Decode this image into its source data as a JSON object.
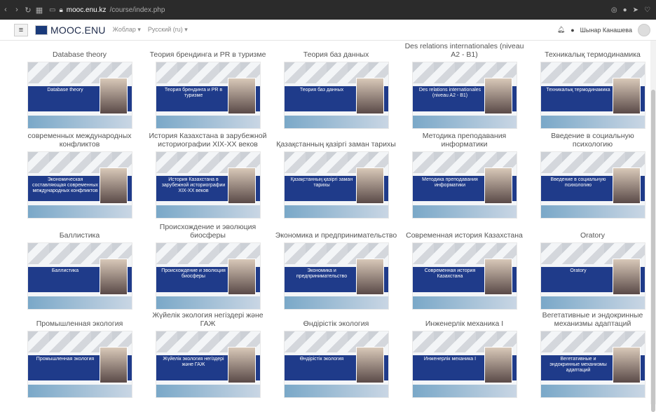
{
  "browser": {
    "url_domain": "mooc.enu.kz",
    "url_path": "/course/index.php",
    "left_icons": [
      "back-icon",
      "forward-icon",
      "reload-icon",
      "apps-icon",
      "tab-icon",
      "lock-icon"
    ],
    "right_icons": [
      "screenshot-icon",
      "shield-icon",
      "send-icon",
      "heart-icon"
    ]
  },
  "header": {
    "site_name": "MOOC.ENU",
    "menu_items": [
      "Жоблар ▾",
      "Русский (ru) ▾"
    ],
    "user_name": "Шынар Канашева"
  },
  "courses": [
    "Database theory",
    "Теория брендинга и PR в туризме",
    "Теория баз данных",
    "Des relations internationales (niveau A2 - B1)",
    "Техникалық термодинамика",
    "Экономическая составляющая современных международных конфликтов",
    "История Казахстана в зарубежной историографии XIX-XX веков",
    "Қазақстанның қазіргі заман тарихы",
    "Методика преподавания информатики",
    "Введение в социальную психологию",
    "Баллистика",
    "Происхождение и эволюция биосферы",
    "Экономика и предпринимательство",
    "Современная история Казахстана",
    "Oratory",
    "Промышленная экология",
    "Жүйелік экология негіздері және ГАЖ",
    "Өндірістік экология",
    "Инженерлік механика I",
    "Вегетативные и эндокринные механизмы адаптаций"
  ]
}
